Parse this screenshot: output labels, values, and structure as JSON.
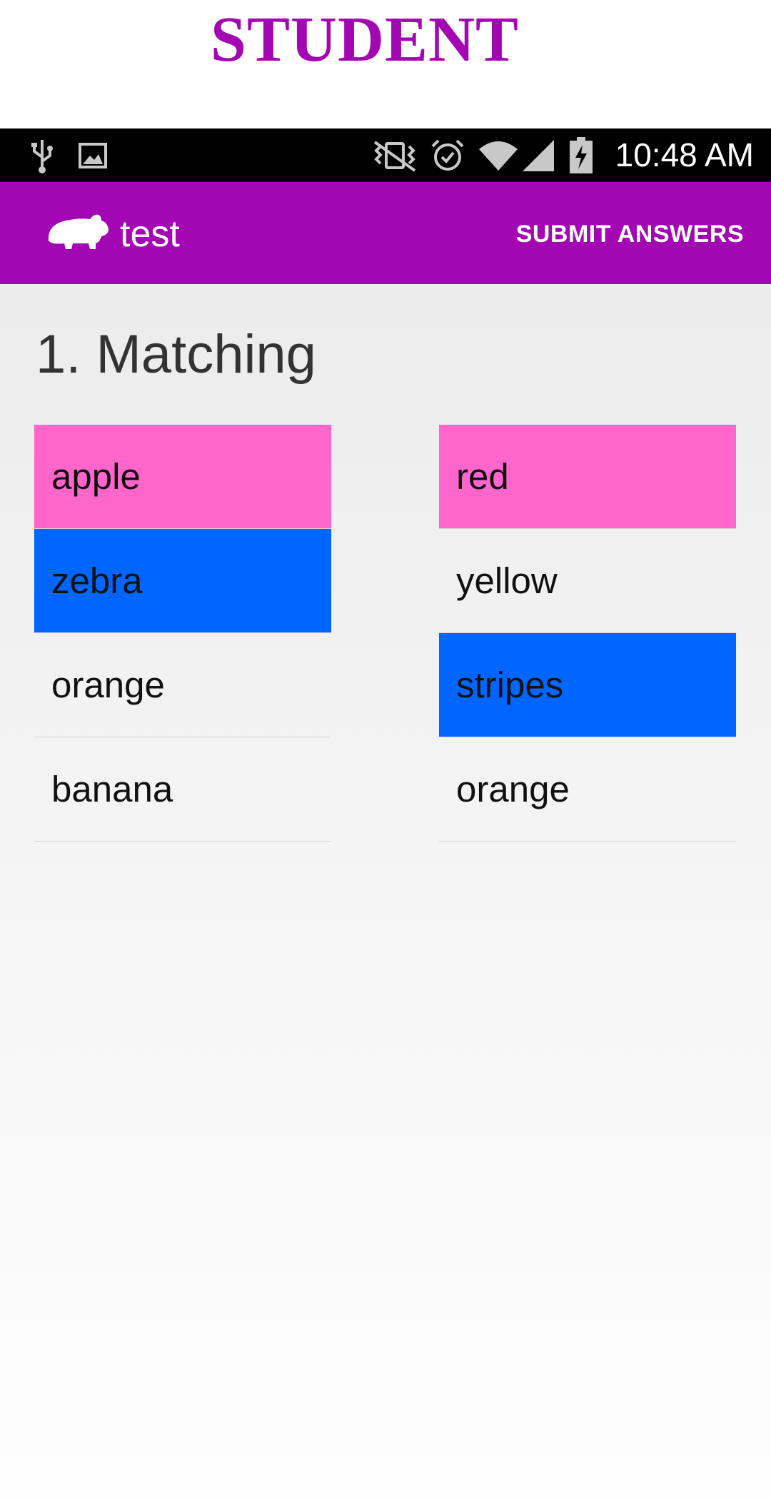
{
  "banner": {
    "title": "STUDENT",
    "color": "#a307b4"
  },
  "status_bar": {
    "time": "10:48 AM",
    "left_icons": [
      "usb-icon",
      "image-icon"
    ],
    "right_icons": [
      "vibrate-icon",
      "alarm-icon",
      "wifi-icon",
      "signal-icon",
      "battery-charging-icon"
    ]
  },
  "app_bar": {
    "title": "test",
    "action_label": "SUBMIT ANSWERS",
    "logo_icon": "hippo-icon",
    "color": "#a307b4"
  },
  "question": {
    "title": "1. Matching",
    "left_items": [
      {
        "label": "apple",
        "color": "#ff66cc"
      },
      {
        "label": "zebra",
        "color": "#0066ff"
      },
      {
        "label": "orange",
        "color": ""
      },
      {
        "label": "banana",
        "color": ""
      }
    ],
    "right_items": [
      {
        "label": "red",
        "color": "#ff66cc"
      },
      {
        "label": "yellow",
        "color": ""
      },
      {
        "label": "stripes",
        "color": "#0066ff"
      },
      {
        "label": "orange",
        "color": ""
      }
    ]
  }
}
